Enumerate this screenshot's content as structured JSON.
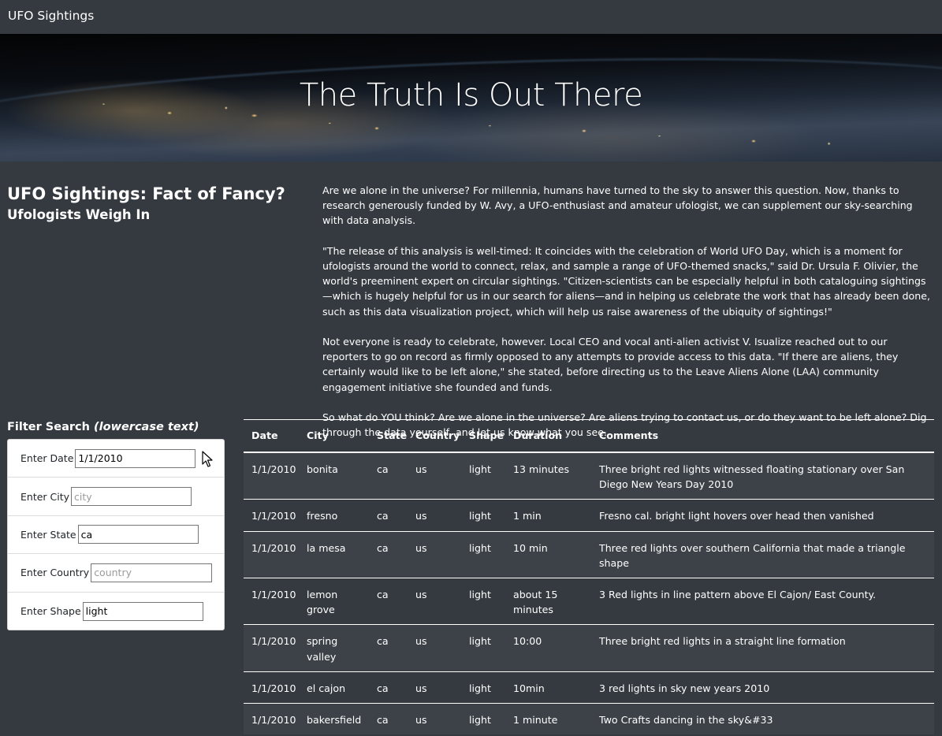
{
  "navbar": {
    "brand": "UFO Sightings"
  },
  "hero": {
    "title": "The Truth Is Out There"
  },
  "article": {
    "title": "UFO Sightings: Fact of Fancy?",
    "subtitle": "Ufologists Weigh In",
    "paragraphs": [
      "Are we alone in the universe? For millennia, humans have turned to the sky to answer this question. Now, thanks to research generously funded by W. Avy, a UFO-enthusiast and amateur ufologist, we can supplement our sky-searching with data analysis.",
      "\"The release of this analysis is well-timed: It coincides with the celebration of World UFO Day, which is a moment for ufologists around the world to connect, relax, and sample a range of UFO-themed snacks,\" said Dr. Ursula F. Olivier, the world's preeminent expert on circular sightings. \"Citizen-scientists can be especially helpful in both cataloguing sightings—which is hugely helpful for us in our search for aliens—and in helping us celebrate the work that has already been done, such as this data visualization project, which will help us raise awareness of the ubiquity of sightings!\"",
      "Not everyone is ready to celebrate, however. Local CEO and vocal anti-alien activist V. Isualize reached out to our reporters to go on record as firmly opposed to any attempts to provide access to this data. \"If there are aliens, they certainly would like to be left alone,\" she stated, before directing us to the Leave Aliens Alone (LAA) community engagement initiative she founded and funds.",
      "So what do YOU think? Are we alone in the universe? Are aliens trying to contact us, or do they want to be left alone? Dig through the data yourself, and let us know what you see."
    ]
  },
  "filters": {
    "heading": "Filter Search",
    "heading_note": "(lowercase text)",
    "fields": [
      {
        "label": "Enter Date",
        "value": "1/1/2010",
        "placeholder": ""
      },
      {
        "label": "Enter City",
        "value": "",
        "placeholder": "city"
      },
      {
        "label": "Enter State",
        "value": "ca",
        "placeholder": ""
      },
      {
        "label": "Enter Country",
        "value": "",
        "placeholder": "country"
      },
      {
        "label": "Enter Shape",
        "value": "light",
        "placeholder": ""
      }
    ]
  },
  "table": {
    "headers": [
      "Date",
      "City",
      "State",
      "Country",
      "Shape",
      "Duration",
      "Comments"
    ],
    "rows": [
      [
        "1/1/2010",
        "bonita",
        "ca",
        "us",
        "light",
        "13 minutes",
        "Three bright red lights witnessed floating stationary over San Diego New Years Day 2010"
      ],
      [
        "1/1/2010",
        "fresno",
        "ca",
        "us",
        "light",
        "1 min",
        "Fresno cal. bright light hovers over head then vanished"
      ],
      [
        "1/1/2010",
        "la mesa",
        "ca",
        "us",
        "light",
        "10 min",
        "Three red lights over southern California that made a triangle shape"
      ],
      [
        "1/1/2010",
        "lemon grove",
        "ca",
        "us",
        "light",
        "about 15 minutes",
        "3 Red lights in line pattern above El Cajon/ East County."
      ],
      [
        "1/1/2010",
        "spring valley",
        "ca",
        "us",
        "light",
        "10:00",
        "Three bright red lights in a straight line formation"
      ],
      [
        "1/1/2010",
        "el cajon",
        "ca",
        "us",
        "light",
        "10min",
        "3 red lights in sky new years 2010"
      ],
      [
        "1/1/2010",
        "bakersfield",
        "ca",
        "us",
        "light",
        "1 minute",
        "Two Crafts dancing in the sky&#33"
      ]
    ]
  }
}
